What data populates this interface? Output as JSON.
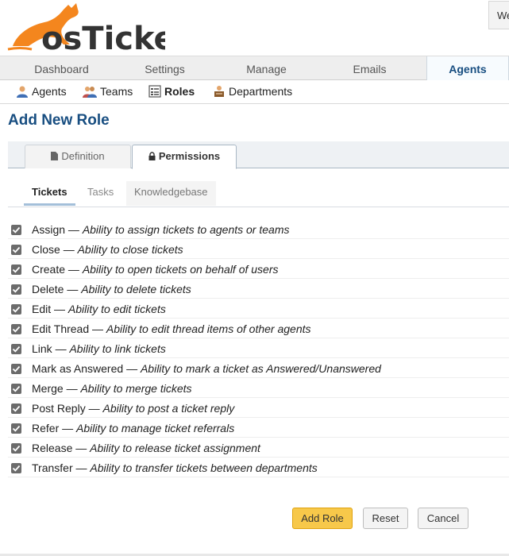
{
  "header": {
    "logo_text": "osTicket",
    "welcome_text": "We"
  },
  "nav": {
    "tabs": [
      {
        "label": "Dashboard"
      },
      {
        "label": "Settings"
      },
      {
        "label": "Manage"
      },
      {
        "label": "Emails"
      },
      {
        "label": "Agents",
        "active": true
      }
    ]
  },
  "subnav": {
    "items": [
      {
        "label": "Agents",
        "icon": "agent-icon"
      },
      {
        "label": "Teams",
        "icon": "team-icon"
      },
      {
        "label": "Roles",
        "icon": "roles-icon",
        "active": true
      },
      {
        "label": "Departments",
        "icon": "department-icon"
      }
    ]
  },
  "page": {
    "title": "Add New Role"
  },
  "tabs": [
    {
      "label": "Definition",
      "icon": "file-icon"
    },
    {
      "label": "Permissions",
      "icon": "lock-icon",
      "active": true
    }
  ],
  "subtabs": [
    {
      "label": "Tickets",
      "active": true
    },
    {
      "label": "Tasks"
    },
    {
      "label": "Knowledgebase"
    }
  ],
  "permissions": [
    {
      "name": "Assign",
      "desc": "Ability to assign tickets to agents or teams",
      "checked": true
    },
    {
      "name": "Close",
      "desc": "Ability to close tickets",
      "checked": true
    },
    {
      "name": "Create",
      "desc": "Ability to open tickets on behalf of users",
      "checked": true
    },
    {
      "name": "Delete",
      "desc": "Ability to delete tickets",
      "checked": true
    },
    {
      "name": "Edit",
      "desc": "Ability to edit tickets",
      "checked": true
    },
    {
      "name": "Edit Thread",
      "desc": "Ability to edit thread items of other agents",
      "checked": true
    },
    {
      "name": "Link",
      "desc": "Ability to link tickets",
      "checked": true
    },
    {
      "name": "Mark as Answered",
      "desc": "Ability to mark a ticket as Answered/Unanswered",
      "checked": true
    },
    {
      "name": "Merge",
      "desc": "Ability to merge tickets",
      "checked": true
    },
    {
      "name": "Post Reply",
      "desc": "Ability to post a ticket reply",
      "checked": true
    },
    {
      "name": "Refer",
      "desc": "Ability to manage ticket referrals",
      "checked": true
    },
    {
      "name": "Release",
      "desc": "Ability to release ticket assignment",
      "checked": true
    },
    {
      "name": "Transfer",
      "desc": "Ability to transfer tickets between departments",
      "checked": true
    }
  ],
  "separator": "—",
  "buttons": {
    "add_role": "Add Role",
    "reset": "Reset",
    "cancel": "Cancel"
  },
  "colors": {
    "brand_orange": "#f4861e",
    "title_blue": "#184e81",
    "primary_button": "#f7c84a"
  }
}
